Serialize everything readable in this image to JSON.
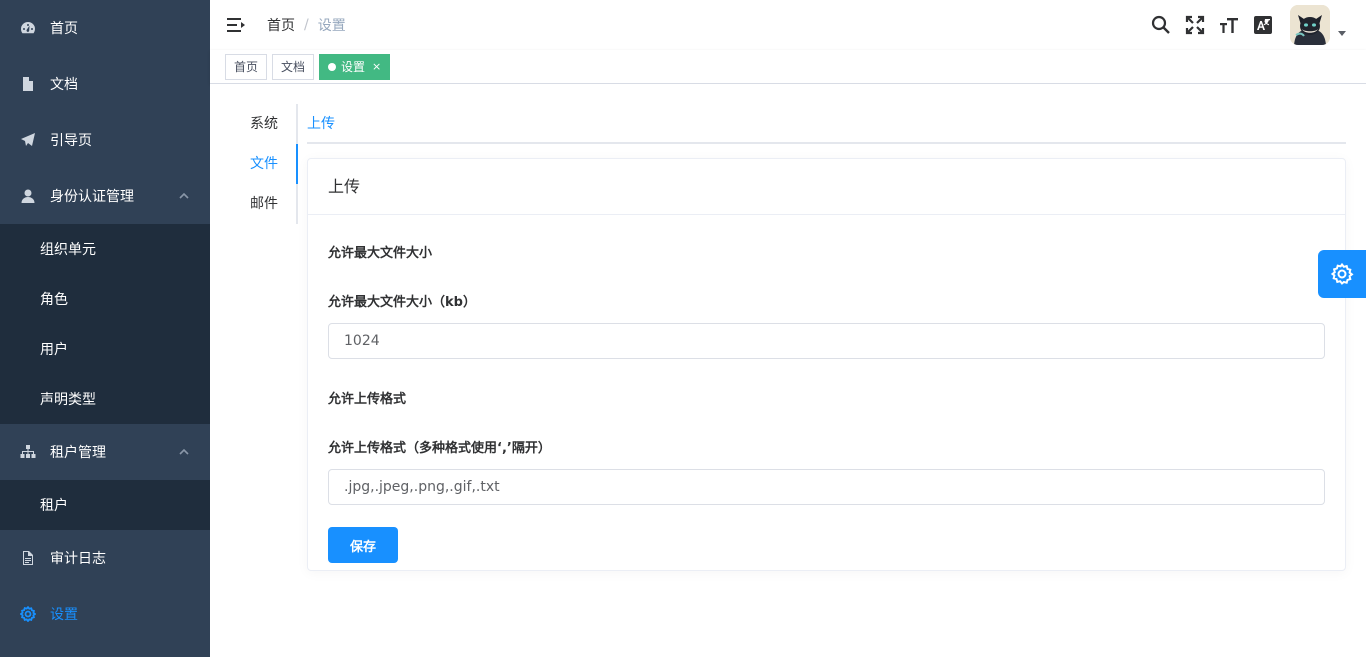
{
  "sidebar": {
    "items": [
      {
        "label": "首页",
        "icon": "dashboard-icon"
      },
      {
        "label": "文档",
        "icon": "document-icon"
      },
      {
        "label": "引导页",
        "icon": "paper-plane-icon"
      },
      {
        "label": "身份认证管理",
        "icon": "user-icon",
        "expanded": true,
        "children": [
          {
            "label": "组织单元"
          },
          {
            "label": "角色"
          },
          {
            "label": "用户"
          },
          {
            "label": "声明类型"
          }
        ]
      },
      {
        "label": "租户管理",
        "icon": "tree-icon",
        "expanded": true,
        "children": [
          {
            "label": "租户"
          }
        ]
      },
      {
        "label": "审计日志",
        "icon": "file-text-icon"
      },
      {
        "label": "设置",
        "icon": "gear-icon",
        "active": true
      }
    ]
  },
  "header": {
    "breadcrumb": {
      "home": "首页",
      "separator": "/",
      "current": "设置"
    },
    "icons": [
      "search-icon",
      "fullscreen-icon",
      "font-size-icon",
      "language-icon"
    ]
  },
  "tags": [
    {
      "label": "首页"
    },
    {
      "label": "文档"
    },
    {
      "label": "设置",
      "active": true,
      "close": "×"
    }
  ],
  "settings": {
    "vertical_tabs": [
      "系统",
      "文件",
      "邮件"
    ],
    "active_vertical_tab": "文件",
    "horizontal_tab": "上传",
    "card_title": "上传",
    "max_size_group": "允许最大文件大小",
    "max_size_label": "允许最大文件大小（kb）",
    "max_size_value": "1024",
    "formats_group": "允许上传格式",
    "formats_label": "允许上传格式（多种格式使用‘,’隔开）",
    "formats_value": ".jpg,.jpeg,.png,.gif,.txt",
    "save_label": "保存"
  },
  "colors": {
    "sidebar_bg": "#304156",
    "submenu_bg": "#1f2d3d",
    "accent": "#1890ff",
    "tag_active": "#42b983"
  }
}
